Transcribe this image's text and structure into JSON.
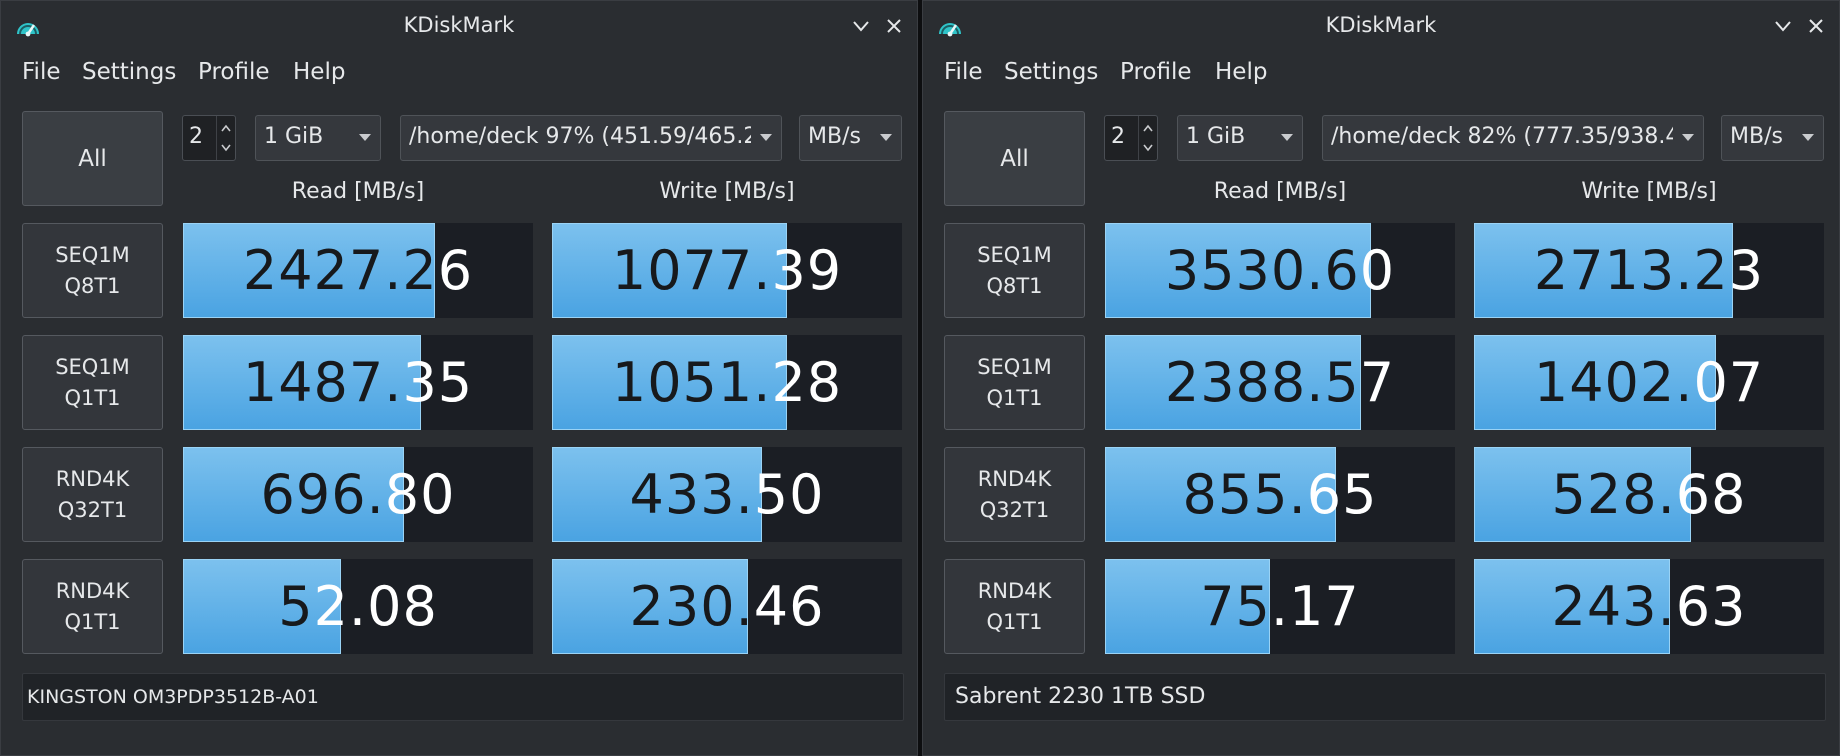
{
  "windows": [
    {
      "title": "KDiskMark",
      "menu": [
        "File",
        "Settings",
        "Profile",
        "Help"
      ],
      "all_label": "All",
      "loops": "2",
      "size": "1 GiB",
      "path": "/home/deck 97% (451.59/465.2",
      "unit": "MB/s",
      "read_header": "Read [MB/s]",
      "write_header": "Write [MB/s]",
      "device": "KINGSTON OM3PDP3512B-A01",
      "rows": [
        {
          "line1": "SEQ1M",
          "line2": "Q8T1",
          "read": "2427.26",
          "write": "1077.39",
          "read_fill": 0.72,
          "write_fill": 0.67
        },
        {
          "line1": "SEQ1M",
          "line2": "Q1T1",
          "read": "1487.35",
          "write": "1051.28",
          "read_fill": 0.68,
          "write_fill": 0.67
        },
        {
          "line1": "RND4K",
          "line2": "Q32T1",
          "read": "696.80",
          "write": "433.50",
          "read_fill": 0.63,
          "write_fill": 0.6
        },
        {
          "line1": "RND4K",
          "line2": "Q1T1",
          "read": "52.08",
          "write": "230.46",
          "read_fill": 0.45,
          "write_fill": 0.56
        }
      ]
    },
    {
      "title": "KDiskMark",
      "menu": [
        "File",
        "Settings",
        "Profile",
        "Help"
      ],
      "all_label": "All",
      "loops": "2",
      "size": "1 GiB",
      "path": "/home/deck 82% (777.35/938.4",
      "unit": "MB/s",
      "read_header": "Read [MB/s]",
      "write_header": "Write [MB/s]",
      "device": "Sabrent 2230 1TB SSD",
      "rows": [
        {
          "line1": "SEQ1M",
          "line2": "Q8T1",
          "read": "3530.60",
          "write": "2713.23",
          "read_fill": 0.76,
          "write_fill": 0.74
        },
        {
          "line1": "SEQ1M",
          "line2": "Q1T1",
          "read": "2388.57",
          "write": "1402.07",
          "read_fill": 0.73,
          "write_fill": 0.69
        },
        {
          "line1": "RND4K",
          "line2": "Q32T1",
          "read": "855.65",
          "write": "528.68",
          "read_fill": 0.66,
          "write_fill": 0.62
        },
        {
          "line1": "RND4K",
          "line2": "Q1T1",
          "read": "75.17",
          "write": "243.63",
          "read_fill": 0.47,
          "write_fill": 0.56
        }
      ]
    }
  ],
  "colors": {
    "bar": "#5fb1e8",
    "cell_bg": "#1b1e24",
    "window_bg": "#2a2d31"
  },
  "icons": [
    "speedometer-icon",
    "minimize-icon",
    "close-icon",
    "spin-up-icon",
    "spin-down-icon",
    "chevron-down-icon"
  ]
}
